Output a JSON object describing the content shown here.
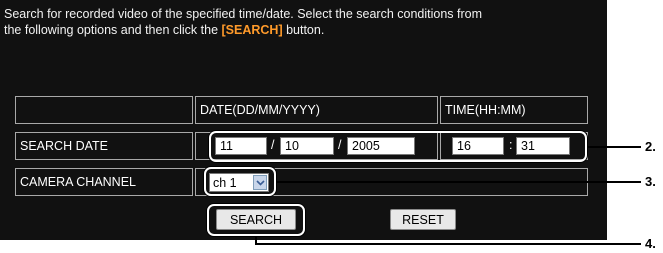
{
  "instructions": {
    "line1": "Search for recorded video of the specified time/date. Select the search conditions from",
    "line2_before": "the following options and then click the ",
    "line2_highlight": "[SEARCH]",
    "line2_after": " button."
  },
  "table": {
    "header_date": "DATE(DD/MM/YYYY)",
    "header_time": "TIME(HH:MM)",
    "row_search_date": "SEARCH DATE",
    "row_camera_channel": "CAMERA CHANNEL"
  },
  "search_date": {
    "day": "11",
    "month": "10",
    "year": "2005",
    "date_separator": "/",
    "hour": "16",
    "minute": "31",
    "time_separator": ":"
  },
  "camera_channel": {
    "selected": "ch 1"
  },
  "buttons": {
    "search": "SEARCH",
    "reset": "RESET"
  },
  "callouts": {
    "c2": "2.",
    "c3": "3.",
    "c4": "4."
  },
  "colors": {
    "panel_bg": "#111111",
    "highlight": "#ff9a2a"
  }
}
